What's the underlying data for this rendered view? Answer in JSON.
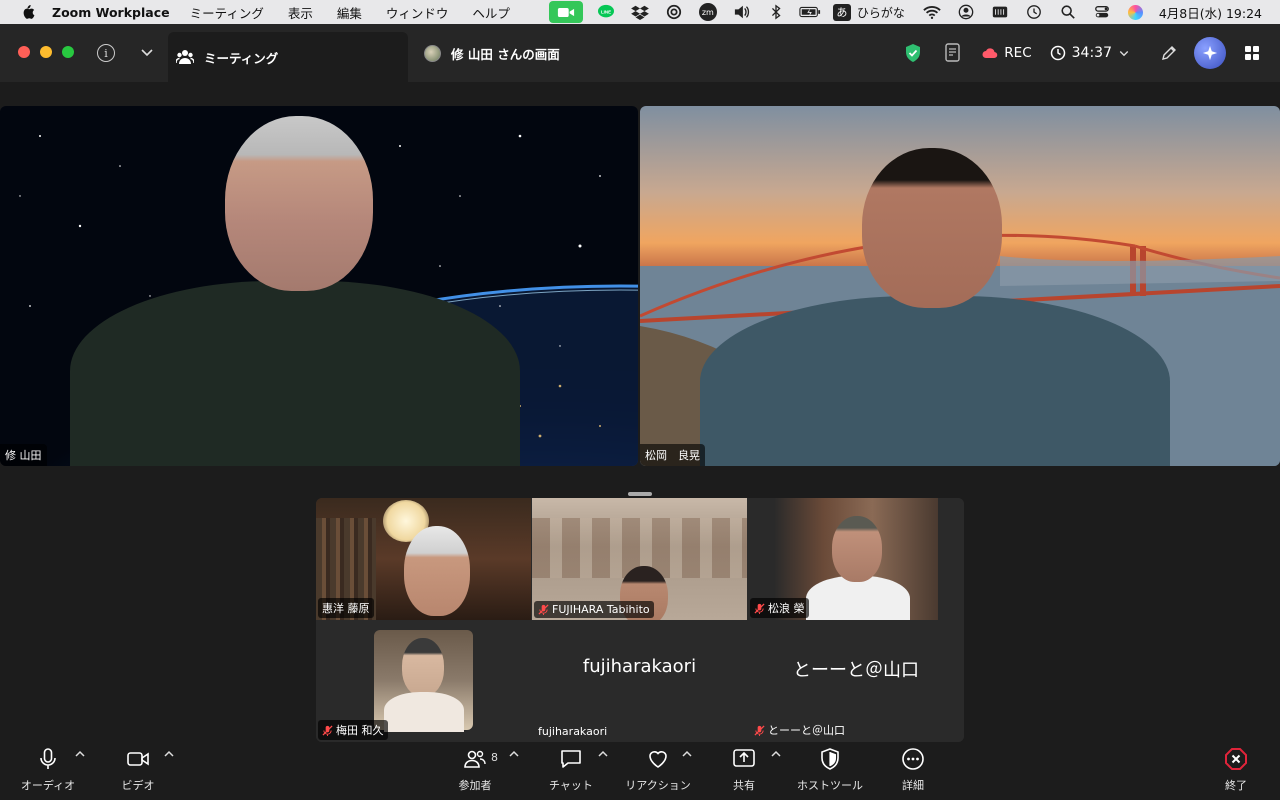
{
  "menubar": {
    "app_name": "Zoom Workplace",
    "menus": [
      "ミーティング",
      "表示",
      "編集",
      "ウィンドウ",
      "ヘルプ"
    ],
    "ime_char": "あ",
    "ime_label": "ひらがな",
    "zoom_badge": "zm",
    "clock": "4月8日(水)  19:24"
  },
  "titlebar": {
    "tab_meeting": "ミーティング",
    "tab_screen": "修 山田 さんの画面",
    "rec_label": "REC",
    "timer": "34:37"
  },
  "videos": {
    "left_name": "修 山田",
    "right_name": "松岡　良晃"
  },
  "gallery": {
    "tiles": [
      {
        "label": "惠洋 藤原"
      },
      {
        "label": "FUJIHARA Tabihito"
      },
      {
        "label": "松浪 榮"
      },
      {
        "label": "梅田 和久"
      },
      {
        "label": "fujiharakaori",
        "center": "fujiharakaori"
      },
      {
        "label": "とーーと＠山口",
        "center": "とーーと＠山口"
      }
    ]
  },
  "toolbar": {
    "audio": "オーディオ",
    "video": "ビデオ",
    "participants": "参加者",
    "participant_count": "8",
    "chat": "チャット",
    "reactions": "リアクション",
    "share": "共有",
    "host_tools": "ホストツール",
    "more": "詳細",
    "end": "終了"
  },
  "colors": {
    "accent_green": "#34c759",
    "end_red": "#e0243a",
    "shield_green": "#2fbf71"
  }
}
